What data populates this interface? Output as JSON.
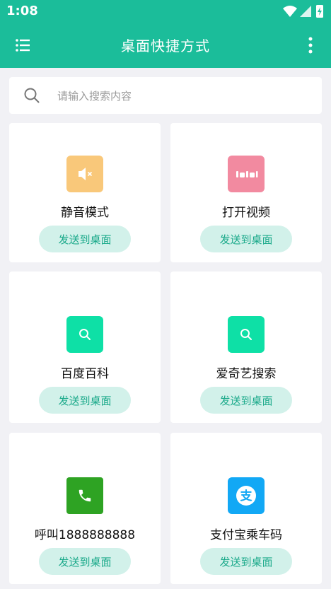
{
  "status": {
    "time": "1:08"
  },
  "appbar": {
    "title": "桌面快捷方式"
  },
  "search": {
    "placeholder": "请输入搜索内容"
  },
  "send_label": "发送到桌面",
  "cards": [
    {
      "label": "静音模式",
      "icon": "mute-icon",
      "color": "#f9c87a"
    },
    {
      "label": "打开视频",
      "icon": "bilibili-icon",
      "color": "#f28aa0"
    },
    {
      "label": "百度百科",
      "icon": "search-icon",
      "color": "#0ee0a6"
    },
    {
      "label": "爱奇艺搜索",
      "icon": "search-icon",
      "color": "#0ee0a6"
    },
    {
      "label": "呼叫1888888888",
      "icon": "phone-icon",
      "color": "#2ea323"
    },
    {
      "label": "支付宝乘车码",
      "icon": "alipay-icon",
      "color": "#12a8f5"
    }
  ],
  "colors": {
    "primary": "#1bbd9a",
    "button_bg": "#d2f1ea",
    "button_text": "#1aa98a"
  }
}
